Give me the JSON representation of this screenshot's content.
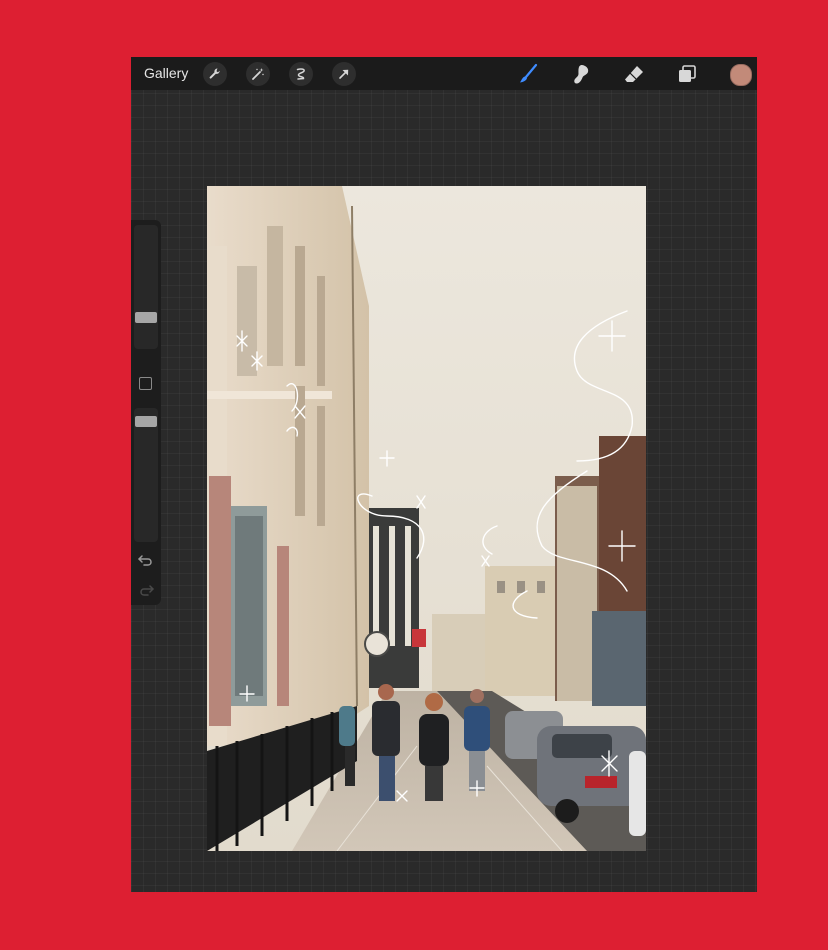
{
  "toolbar": {
    "gallery_label": "Gallery",
    "left_tools": [
      "wrench-icon",
      "magic-wand-icon",
      "selection-icon",
      "transform-arrow-icon"
    ],
    "right_tools": [
      "brush-icon",
      "smudge-icon",
      "eraser-icon",
      "layers-icon"
    ],
    "active_tool": "brush",
    "current_color": "#c28a79"
  },
  "sidebar": {
    "brush_size_level": 0.72,
    "opacity_level": 0.05
  },
  "colors": {
    "background": "#dd1f32",
    "app_background": "#2a2a2a",
    "toolbar": "#1b1b1b",
    "active_tool": "#3f8cff"
  }
}
